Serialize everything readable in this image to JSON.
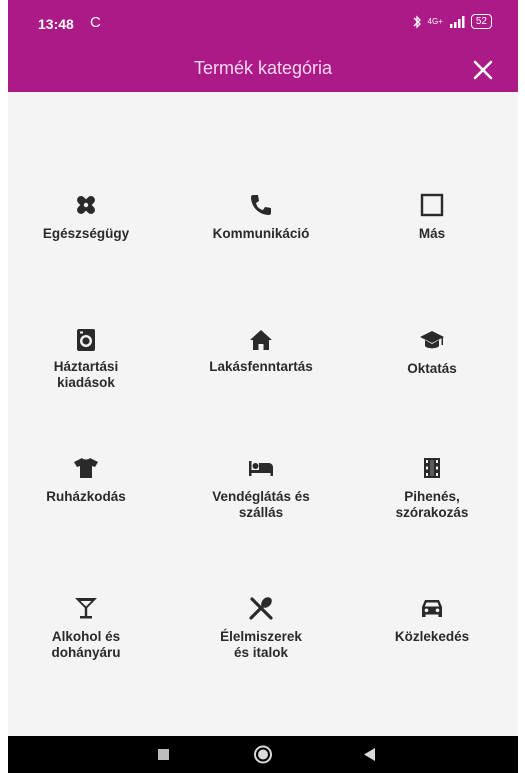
{
  "status_bar": {
    "time": "13:48",
    "sync_glyph": "C",
    "network_label": "4G+",
    "battery": "52"
  },
  "app_bar": {
    "title": "Termék kategória",
    "close_icon": "close-icon"
  },
  "categories": [
    {
      "label": "Egészségügy",
      "icon": "bandage-icon"
    },
    {
      "label": "Kommunikáció",
      "icon": "phone-icon"
    },
    {
      "label": "Más",
      "icon": "square-outline-icon"
    },
    {
      "label": "Háztartási kiadások",
      "icon": "washing-machine-icon"
    },
    {
      "label": "Lakásfenntartás",
      "icon": "house-icon"
    },
    {
      "label": "Oktatás",
      "icon": "graduation-cap-icon"
    },
    {
      "label": "Ruházkodás",
      "icon": "tshirt-icon"
    },
    {
      "label": "Vendéglátás és szállás",
      "icon": "bed-icon"
    },
    {
      "label": "Pihenés, szórakozás",
      "icon": "film-icon"
    },
    {
      "label": "Alkohol és dohányáru",
      "icon": "cocktail-icon"
    },
    {
      "label": "Élelmiszerek és italok",
      "icon": "utensils-icon"
    },
    {
      "label": "Közlekedés",
      "icon": "car-icon"
    }
  ],
  "colors": {
    "brand": "#ab1a86",
    "icon": "#2a2a2a",
    "background": "#f4f4f4"
  },
  "nav_bar": [
    "recents-button",
    "home-button",
    "back-button"
  ]
}
